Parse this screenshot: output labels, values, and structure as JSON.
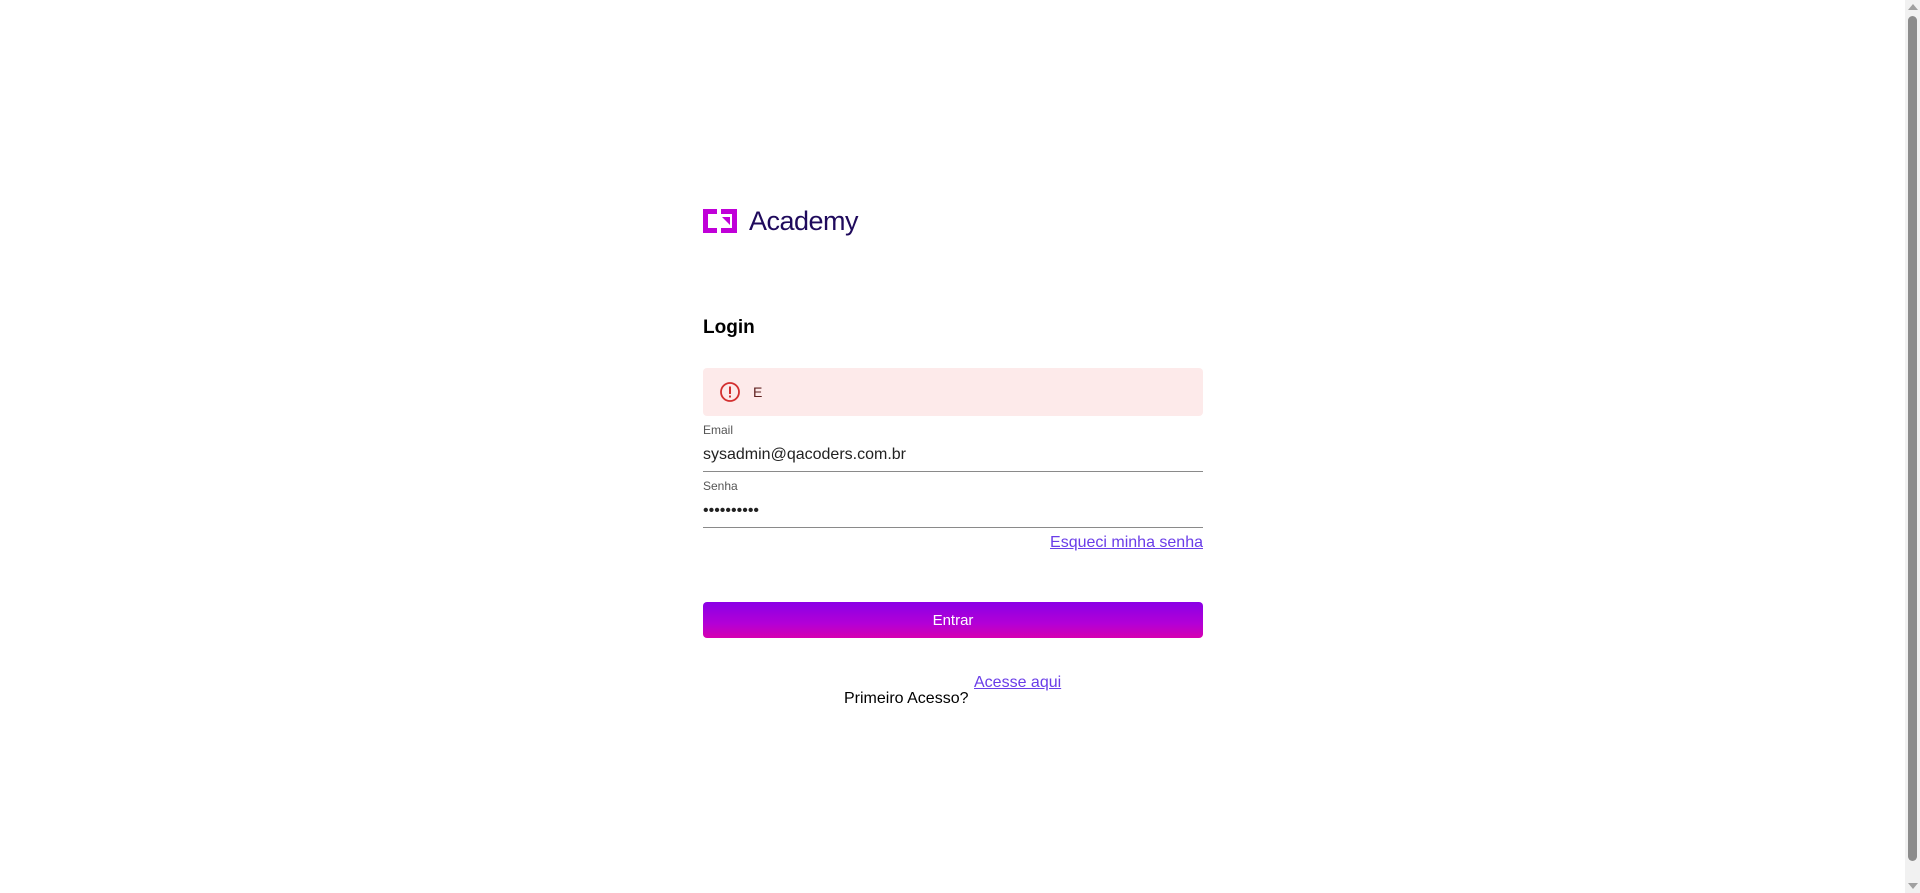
{
  "brand": {
    "name": "Academy",
    "mark_color": "#c000d8",
    "text_color": "#1f0a5c"
  },
  "login": {
    "title": "Login",
    "error": {
      "icon": "error-circle-icon",
      "message": "E",
      "background": "#fdeaea",
      "icon_color": "#d32f2f"
    },
    "email": {
      "label": "Email",
      "value": "sysadmin@qacoders.com.br"
    },
    "password": {
      "label": "Senha",
      "value": "••••••••••"
    },
    "forgot_password": "Esqueci minha senha",
    "submit_label": "Entrar",
    "first_access": {
      "text": "Primeiro Acesso?",
      "link": "Acesse aqui"
    },
    "link_color": "#6a3de8"
  }
}
